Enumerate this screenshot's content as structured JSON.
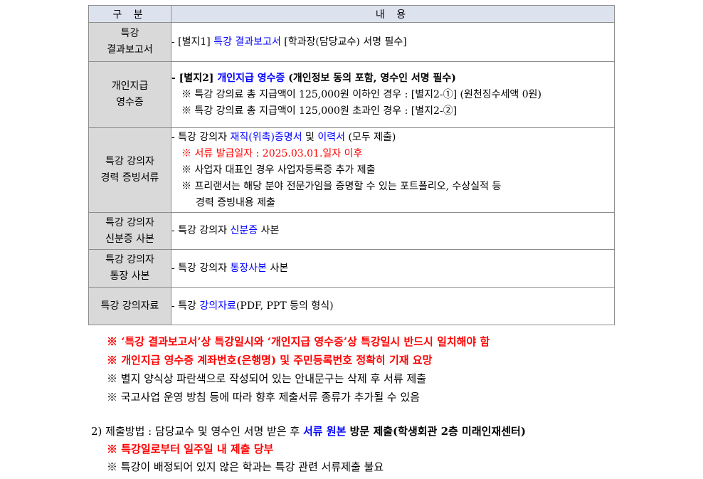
{
  "table": {
    "headers": [
      "구 분",
      "내 용"
    ],
    "rows": {
      "report": {
        "category": [
          "특강",
          "결과보고서"
        ],
        "l1": {
          "a": "- [별지1] ",
          "b": "특강 결과보고서",
          "c": " [학과장(담당교수) 서명 필수]"
        }
      },
      "receipt": {
        "category": [
          "개인지급",
          "영수증"
        ],
        "l1": {
          "a": "- [별지2] ",
          "b": "개인지급 영수증",
          "c": " (개인정보 동의 포함, 영수인 서명 필수)"
        },
        "l2": "※ 특강 강의료 총 지급액이 125,000원 이하인 경우 : [별지2-①] (원천징수세액 0원)",
        "l3": "※ 특강 강의료 총 지급액이 125,000원 초과인 경우 : [별지2-②]"
      },
      "career": {
        "category": [
          "특강 강의자",
          "경력 증빙서류"
        ],
        "l1": {
          "a": "- 특강 강의자 ",
          "b": "재직(위촉)증명서",
          "c": " 및 ",
          "d": "이력서",
          "e": " (모두 제출)"
        },
        "l2": "※ 서류 발급일자 : 2025.03.01.일자 이후",
        "l3": "※ 사업자 대표인 경우 사업자등록증 추가 제출",
        "l4": "※ 프리랜서는 해당 분야 전문가임을 증명할 수 있는 포트폴리오, 수상실적 등",
        "l5": "경력 증빙내용 제출"
      },
      "id": {
        "category": [
          "특강 강의자",
          "신분증 사본"
        ],
        "l1": {
          "a": "- 특강 강의자 ",
          "b": "신분증",
          "c": " 사본"
        }
      },
      "bank": {
        "category": [
          "특강 강의자",
          "통장 사본"
        ],
        "l1": {
          "a": "- 특강 강의자 ",
          "b": "통장사본",
          "c": " 사본"
        }
      },
      "material": {
        "category": [
          "특강 강의자료"
        ],
        "l1": {
          "a": "- 특강 ",
          "b": "강의자료",
          "c": "(PDF, PPT 등의 형식)"
        }
      }
    }
  },
  "notes": [
    "※ ‘특강 결과보고서’상 특강일시와 ‘개인지급 영수증’상 특강일시 반드시 일치해야 함",
    "※ 개인지급 영수증 계좌번호(은행명) 및 주민등록번호 정확히 기재 요망",
    "※ 별지 양식상 파란색으로 작성되어 있는 안내문구는 삭제 후 서류 제출",
    "※ 국고사업 운영 방침 등에 따라 향후 제출서류 종류가 추가될 수 있음"
  ],
  "method": {
    "l1": {
      "a": "2) 제출방법 : 담당교수 및 영수인 서명 받은 후 ",
      "b": "서류 원본",
      "c": " 방문 제출(학생회관 2층 미래인재센터)"
    },
    "l2": "※ 특강일로부터 일주일 내 제출 당부",
    "l3": "※ 특강이 배정되어 있지 않은 학과는 특강 관련 서류제출 불요"
  },
  "colors": {
    "header_bg": "#dde3ee",
    "category_bg": "#d9d9d9",
    "blue": "#0000ff",
    "red": "#ff0000"
  }
}
